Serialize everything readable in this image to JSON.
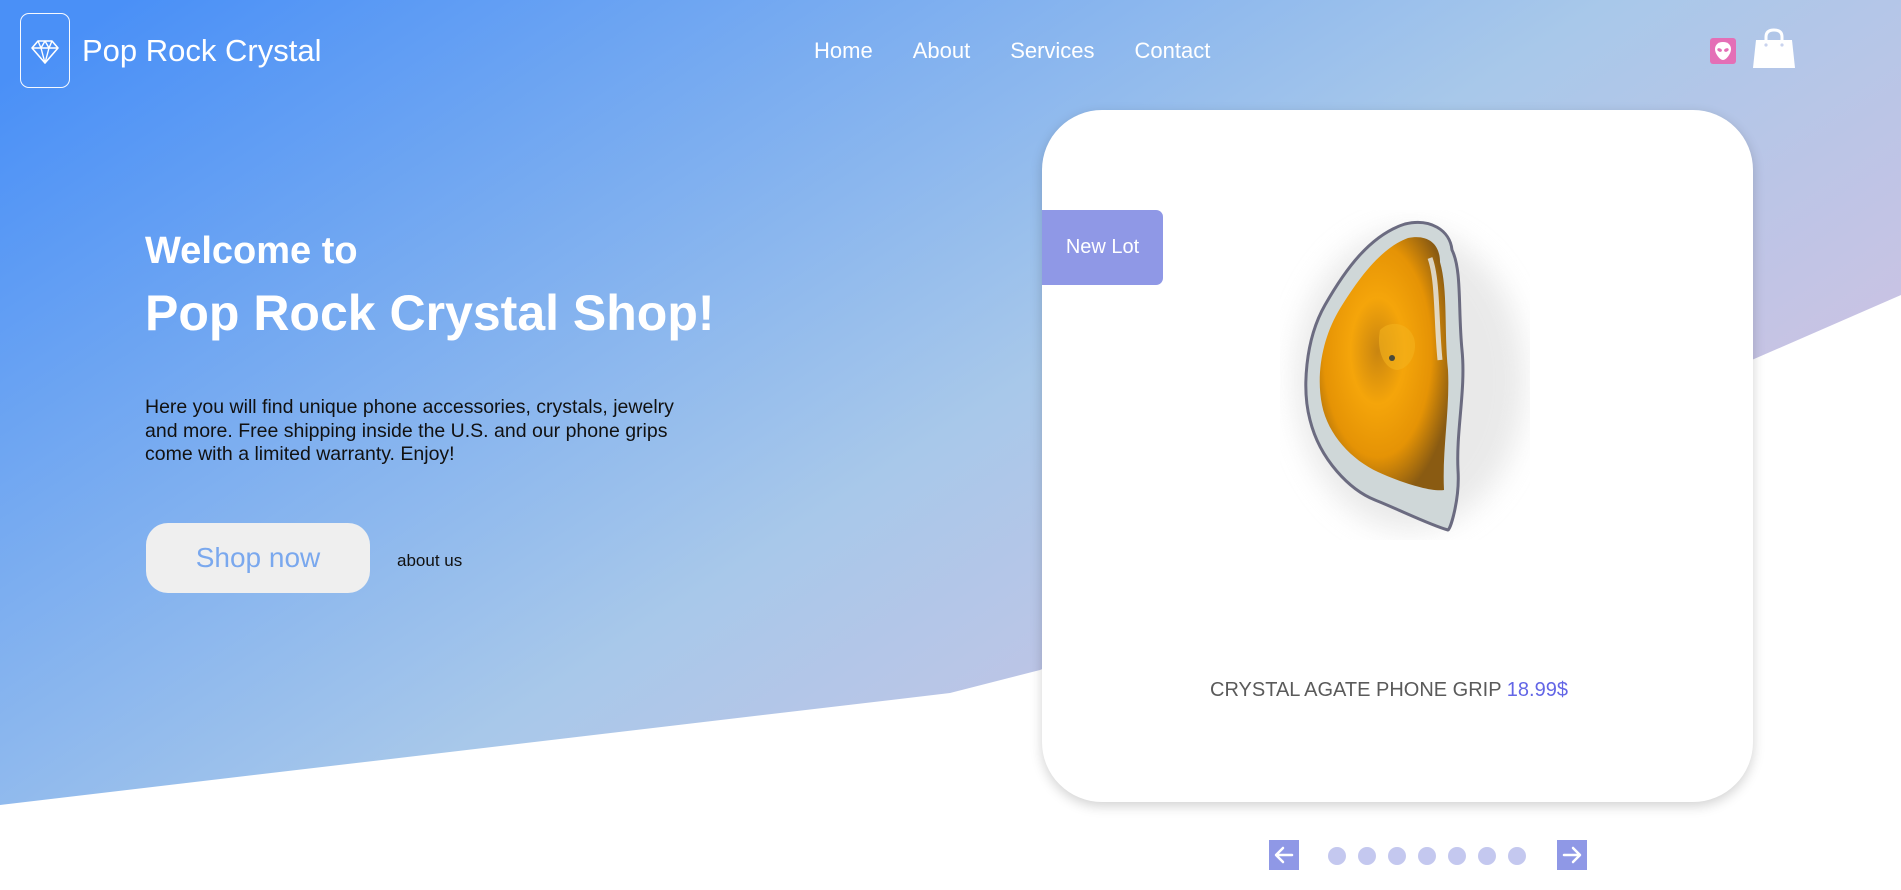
{
  "brand": {
    "name": "Pop Rock Crystal",
    "logo_icon": "diamond-icon"
  },
  "nav": {
    "items": [
      {
        "label": "Home"
      },
      {
        "label": "About"
      },
      {
        "label": "Services"
      },
      {
        "label": "Contact"
      }
    ]
  },
  "header_icons": {
    "user": "alien-icon",
    "cart": "shopping-bag-icon"
  },
  "hero": {
    "welcome": "Welcome to",
    "title": "Pop Rock Crystal Shop!",
    "description": "Here you will find unique phone accessories, crystals, jewelry and more. Free shipping inside the U.S. and our phone grips come with a limited warranty. Enjoy!",
    "shop_button": "Shop now",
    "about_link": "about us"
  },
  "product": {
    "badge": "New Lot",
    "name": "CRYSTAL AGATE PHONE GRIP",
    "price": "18.99$"
  },
  "carousel": {
    "prev_icon": "arrow-left-icon",
    "next_icon": "arrow-right-icon",
    "dot_count": 7
  },
  "colors": {
    "gradient_start": "#4a90f7",
    "gradient_mid": "#a8c8ea",
    "gradient_end": "#d8bfe0",
    "accent": "#8f98e6",
    "price": "#6366e6",
    "button_text": "#7aa8ee"
  }
}
